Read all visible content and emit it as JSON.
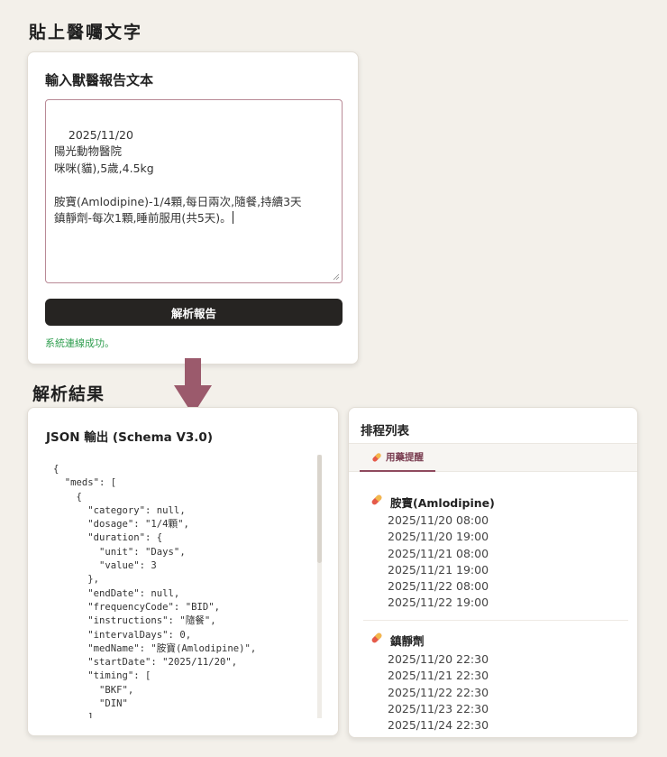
{
  "input_section": {
    "heading": "貼上醫囑文字",
    "card_title": "輸入獸醫報告文本",
    "textarea_value": "2025/11/20\n陽光動物醫院\n咪咪(貓),5歲,4.5kg\n\n胺寶(Amlodipine)-1/4顆,每日兩次,隨餐,持續3天\n鎮靜劑-每次1顆,睡前服用(共5天)。",
    "parse_button": "解析報告",
    "status_text": "系統連線成功。",
    "status_color": "#2f9e4f",
    "accent_color": "#9b5a6c"
  },
  "result_section": {
    "heading": "解析結果",
    "json_card_title": "JSON 輸出 (Schema V3.0)",
    "json_text": "{\n  \"meds\": [\n    {\n      \"category\": null,\n      \"dosage\": \"1/4顆\",\n      \"duration\": {\n        \"unit\": \"Days\",\n        \"value\": 3\n      },\n      \"endDate\": null,\n      \"frequencyCode\": \"BID\",\n      \"instructions\": \"隨餐\",\n      \"intervalDays\": 0,\n      \"medName\": \"胺寶(Amlodipine)\",\n      \"startDate\": \"2025/11/20\",\n      \"timing\": [\n        \"BKF\",\n        \"DIN\"\n      ]"
  },
  "schedule": {
    "card_title": "排程列表",
    "tab_icon": "pill-icon",
    "tab_label": "用藥提醒",
    "meds": [
      {
        "name": "胺寶(Amlodipine)",
        "icon": "pill-icon",
        "times": [
          "2025/11/20 08:00",
          "2025/11/20 19:00",
          "2025/11/21 08:00",
          "2025/11/21 19:00",
          "2025/11/22 08:00",
          "2025/11/22 19:00"
        ]
      },
      {
        "name": "鎮靜劑",
        "icon": "pill-icon",
        "times": [
          "2025/11/20 22:30",
          "2025/11/21 22:30",
          "2025/11/22 22:30",
          "2025/11/23 22:30",
          "2025/11/24 22:30"
        ]
      }
    ]
  }
}
